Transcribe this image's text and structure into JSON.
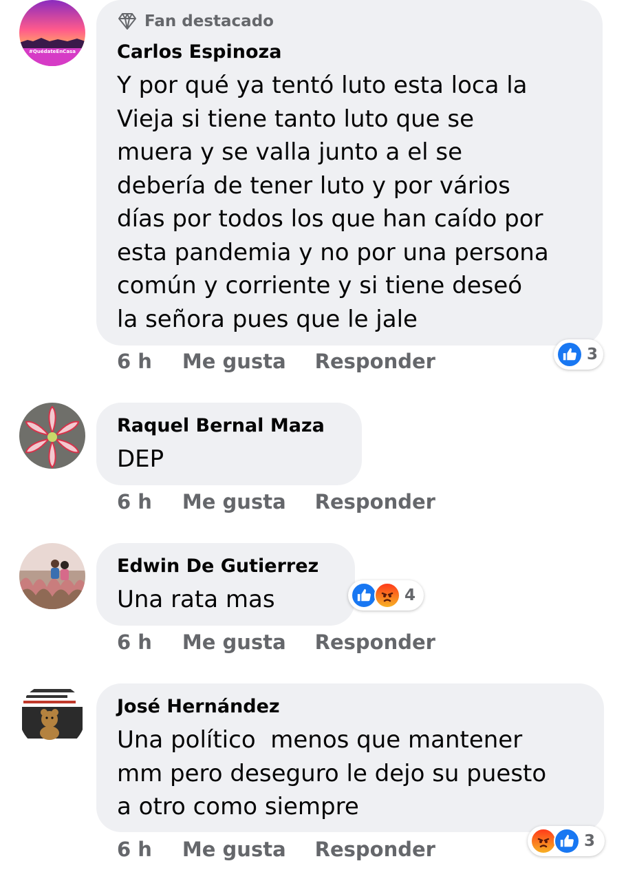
{
  "comments": [
    {
      "badge": "Fan destacado",
      "author": "Carlos Espinoza",
      "text": "Y por qué ya tentó luto esta loca la\nVieja si tiene tanto luto que se\nmuera y se valla junto a el se\ndebería de tener luto y por vários\ndías por todos los que han caído por\nesta pandemia y no por una persona\ncomún y corriente y si tiene deseó\nla señora pues que le jale",
      "time": "6 h",
      "like_label": "Me gusta",
      "reply_label": "Responder",
      "reactions": [
        "like-icon"
      ],
      "reaction_count": "3",
      "avatar_text": "#QuédateEnCasa"
    },
    {
      "author": "Raquel Bernal Maza",
      "text": "DEP",
      "time": "6 h",
      "like_label": "Me gusta",
      "reply_label": "Responder"
    },
    {
      "author": "Edwin De Gutierrez",
      "text": "Una rata mas",
      "time": "6 h",
      "like_label": "Me gusta",
      "reply_label": "Responder",
      "reactions": [
        "like-icon",
        "angry-icon"
      ],
      "reaction_count": "4"
    },
    {
      "author": "José Hernández",
      "text": "Una político  menos que mantener\nmm pero deseguro le dejo su puesto\na otro como siempre",
      "time": "6 h",
      "like_label": "Me gusta",
      "reply_label": "Responder",
      "reactions": [
        "angry-icon",
        "like-icon"
      ],
      "reaction_count": "3"
    }
  ],
  "colors": {
    "bubble": "#eff0f3",
    "secondary_text": "#65676b",
    "like_blue": "#1877f2"
  }
}
